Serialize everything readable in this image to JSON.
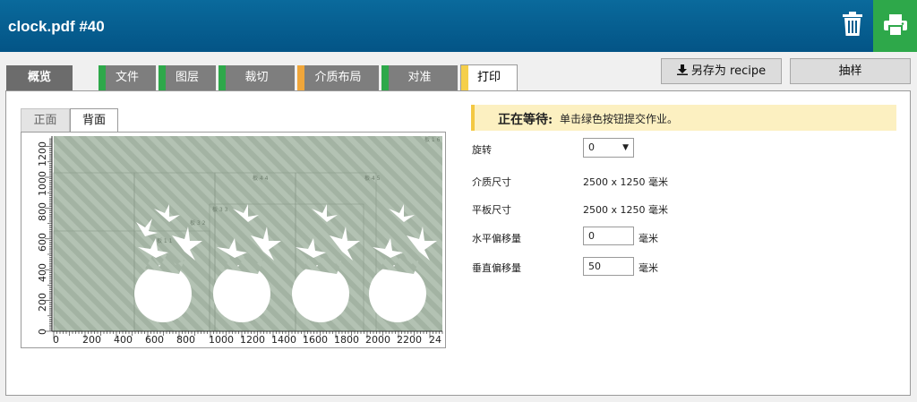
{
  "header": {
    "title": "clock.pdf #40",
    "trash_icon": "trash-icon",
    "print_icon": "printer-icon",
    "print_color": "#2ea84a"
  },
  "tabs": [
    {
      "label": "概览"
    },
    {
      "label": "文件",
      "stripe": "#2ea84a"
    },
    {
      "label": "图层",
      "stripe": "#2ea84a"
    },
    {
      "label": "裁切",
      "stripe": "#2ea84a"
    },
    {
      "label": "介质布局",
      "stripe": "#f0a63a"
    },
    {
      "label": "对准",
      "stripe": "#2ea84a"
    },
    {
      "label": "打印",
      "stripe": "#f5cf4a",
      "active": true
    }
  ],
  "toolbar": {
    "save_label": "另存为 recipe",
    "download_icon": "download-icon",
    "sample_label": "抽样"
  },
  "side_tabs": {
    "front": "正面",
    "back": "背面"
  },
  "preview": {
    "y_ticks": [
      "0",
      "200",
      "400",
      "600",
      "800",
      "1000",
      "1200"
    ],
    "x_ticks": [
      "0",
      "200",
      "400",
      "600",
      "800",
      "1000",
      "1200",
      "1400",
      "1600",
      "1800",
      "2000",
      "2200",
      "24"
    ],
    "tiles": [
      "板 1 6",
      "板 4 5",
      "板 4 4",
      "板 3 3",
      "板 3 2",
      "板 1 1"
    ]
  },
  "status": {
    "strong": "正在等待:",
    "message": "单击绿色按钮提交作业。"
  },
  "form": {
    "rotate_label": "旋转",
    "rotate_value": "0",
    "media_size_label": "介质尺寸",
    "media_size_value": "2500 x 1250 毫米",
    "bed_size_label": "平板尺寸",
    "bed_size_value": "2500 x 1250 毫米",
    "h_offset_label": "水平偏移量",
    "h_offset_value": "0",
    "h_offset_unit": "毫米",
    "v_offset_label": "垂直偏移量",
    "v_offset_value": "50",
    "v_offset_unit": "毫米"
  }
}
